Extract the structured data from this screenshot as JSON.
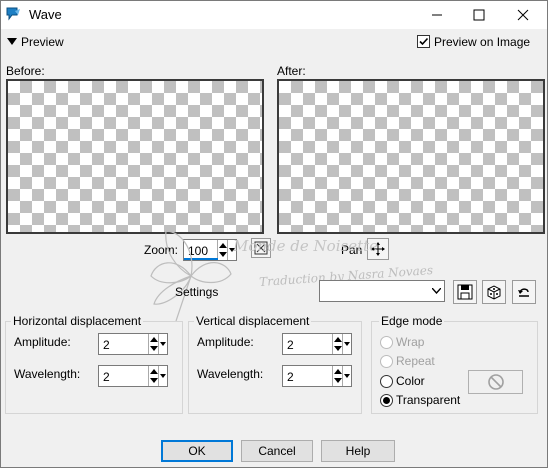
{
  "window": {
    "title": "Wave"
  },
  "preview": {
    "section_label": "Preview",
    "preview_on_image_label": "Preview on Image",
    "preview_on_image_checked": true,
    "before_label": "Before:",
    "after_label": "After:"
  },
  "zoom": {
    "label": "Zoom:",
    "value": "100",
    "pan_label": "Pan"
  },
  "watermark": {
    "line1": "Monde de Noisette",
    "line2": "Traduction by Nasra Novaes"
  },
  "settings": {
    "label": "Settings",
    "selected": ""
  },
  "horizontal": {
    "title": "Horizontal displacement",
    "amplitude_label": "Amplitude:",
    "amplitude": "2",
    "wavelength_label": "Wavelength:",
    "wavelength": "2"
  },
  "vertical": {
    "title": "Vertical displacement",
    "amplitude_label": "Amplitude:",
    "amplitude": "2",
    "wavelength_label": "Wavelength:",
    "wavelength": "2"
  },
  "edge_mode": {
    "title": "Edge mode",
    "options": [
      {
        "label": "Wrap",
        "enabled": false,
        "selected": false
      },
      {
        "label": "Repeat",
        "enabled": false,
        "selected": false
      },
      {
        "label": "Color",
        "enabled": true,
        "selected": false
      },
      {
        "label": "Transparent",
        "enabled": true,
        "selected": true
      }
    ]
  },
  "buttons": {
    "ok": "OK",
    "cancel": "Cancel",
    "help": "Help"
  },
  "colors": {
    "accent": "#0078d7",
    "checker_dark": "#c0c0c0",
    "checker_light": "#ffffff"
  }
}
